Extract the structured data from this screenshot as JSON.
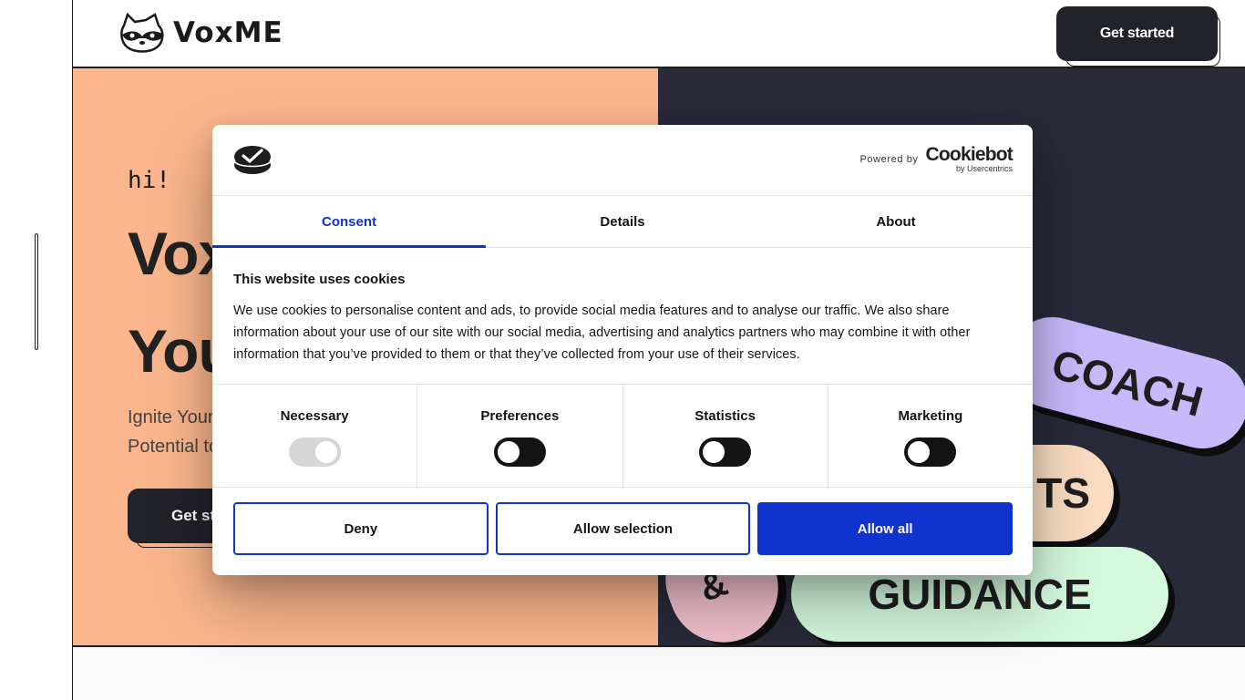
{
  "site": {
    "brand": "VoxME",
    "header_cta": "Get started"
  },
  "hero": {
    "greeting": "hi!",
    "title_line1": "Vox",
    "title_line2": "You",
    "subtitle_line1": "Ignite Your",
    "subtitle_line2": "Potential to",
    "cta": "Get st"
  },
  "pills": {
    "coach": "COACH",
    "ts": "TS",
    "amp": "&",
    "guidance": "GUIDANCE"
  },
  "cookie_dialog": {
    "powered_by": "Powered by",
    "provider": "Cookiebot",
    "provider_sub": "by Usercentrics",
    "tabs": [
      {
        "label": "Consent",
        "active": true
      },
      {
        "label": "Details",
        "active": false
      },
      {
        "label": "About",
        "active": false
      }
    ],
    "heading": "This website uses cookies",
    "text": "We use cookies to personalise content and ads, to provide social media features and to analyse our traffic. We also share information about your use of our site with our social media, advertising and analytics partners who may combine it with other information that you’ve provided to them or that they’ve collected from your use of their services.",
    "categories": [
      {
        "label": "Necessary",
        "checked": true,
        "disabled": true
      },
      {
        "label": "Preferences",
        "checked": false,
        "disabled": false
      },
      {
        "label": "Statistics",
        "checked": false,
        "disabled": false
      },
      {
        "label": "Marketing",
        "checked": false,
        "disabled": false
      }
    ],
    "buttons": {
      "deny": "Deny",
      "allow_selection": "Allow selection",
      "allow_all": "Allow all"
    }
  },
  "colors": {
    "accent": "#1032cf",
    "hero_left": "#fbb68d",
    "hero_right": "#282a3a"
  }
}
